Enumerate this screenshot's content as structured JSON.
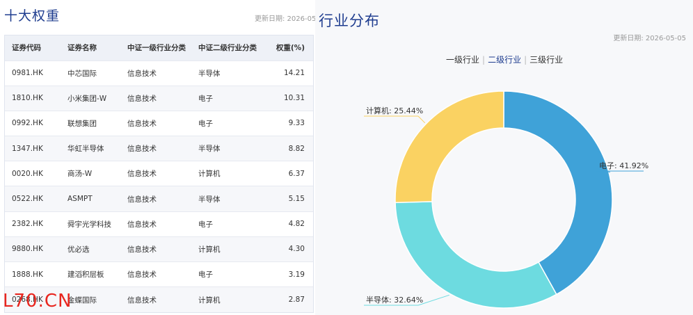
{
  "left": {
    "title": "十大权重",
    "date": "更新日期: 2026-05-05",
    "columns": [
      "证券代码",
      "证券名称",
      "中证一级行业分类",
      "中证二级行业分类",
      "权重(%)"
    ],
    "rows": [
      [
        "0981.HK",
        "中芯国际",
        "信息技术",
        "半导体",
        "14.21"
      ],
      [
        "1810.HK",
        "小米集团-W",
        "信息技术",
        "电子",
        "10.31"
      ],
      [
        "0992.HK",
        "联想集团",
        "信息技术",
        "电子",
        "9.33"
      ],
      [
        "1347.HK",
        "华虹半导体",
        "信息技术",
        "半导体",
        "8.82"
      ],
      [
        "0020.HK",
        "商汤-W",
        "信息技术",
        "计算机",
        "6.37"
      ],
      [
        "0522.HK",
        "ASMPT",
        "信息技术",
        "半导体",
        "5.15"
      ],
      [
        "2382.HK",
        "舜宇光学科技",
        "信息技术",
        "电子",
        "4.82"
      ],
      [
        "9880.HK",
        "优必选",
        "信息技术",
        "计算机",
        "4.30"
      ],
      [
        "1888.HK",
        "建滔积层板",
        "信息技术",
        "电子",
        "3.19"
      ],
      [
        "0268.HK",
        "金蝶国际",
        "信息技术",
        "计算机",
        "2.87"
      ]
    ]
  },
  "right": {
    "title": "行业分布",
    "date": "更新日期: 2026-05-05",
    "tabs": [
      "一级行业",
      "二级行业",
      "三级行业"
    ],
    "active_tab": 1
  },
  "watermark": "L70.CN",
  "chart_data": {
    "type": "pie",
    "donut": true,
    "slices": [
      {
        "name": "电子",
        "value": 41.92,
        "label": "电子: 41.92%",
        "color": "#3fa2d8"
      },
      {
        "name": "半导体",
        "value": 32.64,
        "label": "半导体: 32.64%",
        "color": "#6ddbe0"
      },
      {
        "name": "计算机",
        "value": 25.44,
        "label": "计算机: 25.44%",
        "color": "#fad262"
      }
    ]
  }
}
